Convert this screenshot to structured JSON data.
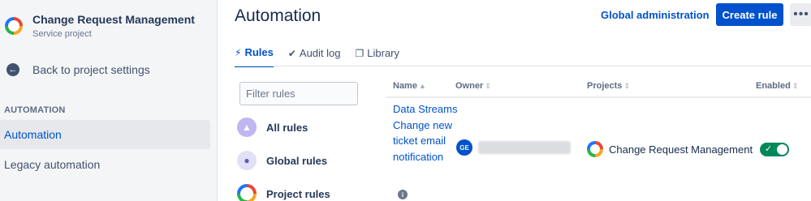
{
  "sidebar": {
    "project_name": "Change Request Management",
    "project_type": "Service project",
    "back_label": "Back to project settings",
    "section_label": "AUTOMATION",
    "items": [
      {
        "label": "Automation"
      },
      {
        "label": "Legacy automation"
      }
    ]
  },
  "header": {
    "title": "Automation",
    "global_admin": "Global administration",
    "create_rule": "Create rule",
    "more": "•••"
  },
  "tabs": [
    {
      "label": "Rules",
      "icon": "lightning-icon"
    },
    {
      "label": "Audit log",
      "icon": "check-circle-icon"
    },
    {
      "label": "Library",
      "icon": "copy-icon"
    }
  ],
  "filter": {
    "placeholder": "Filter rules",
    "categories": [
      {
        "label": "All rules",
        "icon": "all-rules-icon"
      },
      {
        "label": "Global rules",
        "icon": "globe-icon"
      },
      {
        "label": "Project rules",
        "icon": "project-icon"
      }
    ]
  },
  "table": {
    "columns": [
      "Name",
      "Owner",
      "Projects",
      "Enabled"
    ],
    "sort_indicator": "▲",
    "sort_neutral": "⇕",
    "rows": [
      {
        "name": "Data Streams Change new ticket email notification",
        "owner_initials": "GE",
        "project": "Change Request Management",
        "enabled": true
      }
    ]
  },
  "colors": {
    "accent": "#0052cc",
    "toggle_on": "#00875a",
    "sidebar_bg": "#f4f5f7"
  }
}
